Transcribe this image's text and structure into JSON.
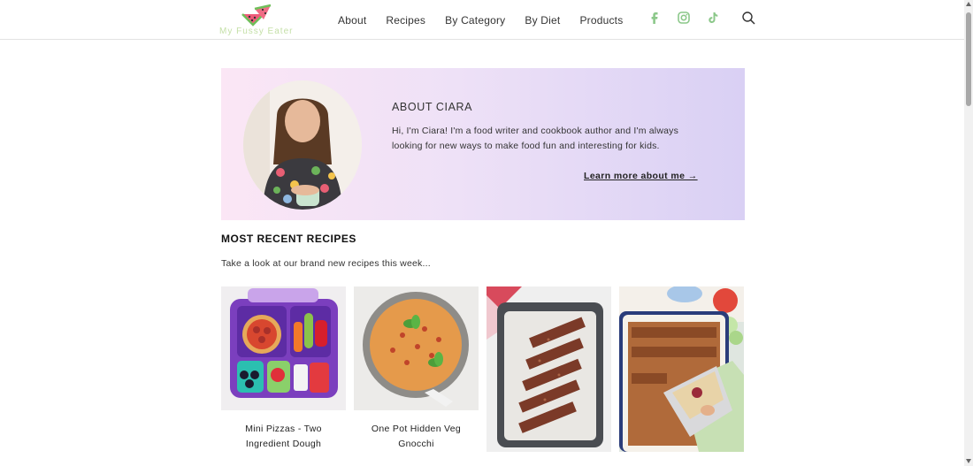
{
  "brand": {
    "logo_text": "My Fussy Eater"
  },
  "nav": {
    "items": [
      {
        "label": "About"
      },
      {
        "label": "Recipes"
      },
      {
        "label": "By Category"
      },
      {
        "label": "By Diet"
      },
      {
        "label": "Products"
      }
    ]
  },
  "social": [
    "facebook-icon",
    "instagram-icon",
    "tiktok-icon"
  ],
  "about": {
    "title": "ABOUT CIARA",
    "text": "Hi, I'm Ciara! I'm a food writer and cookbook author and I'm always looking for new ways to make food fun and interesting for kids.",
    "link": "Learn more about me →"
  },
  "recent": {
    "heading": "MOST RECENT RECIPES",
    "subtitle": "Take a look at our brand new recipes this week...",
    "cards": [
      {
        "title": "Mini Pizzas - Two Ingredient Dough"
      },
      {
        "title": "One Pot Hidden Veg Gnocchi"
      },
      {
        "title": ""
      },
      {
        "title": ""
      }
    ]
  },
  "colors": {
    "social": "#8cc88a",
    "about_gradient_start": "#fbe6f5",
    "about_gradient_end": "#d9d0f4"
  }
}
